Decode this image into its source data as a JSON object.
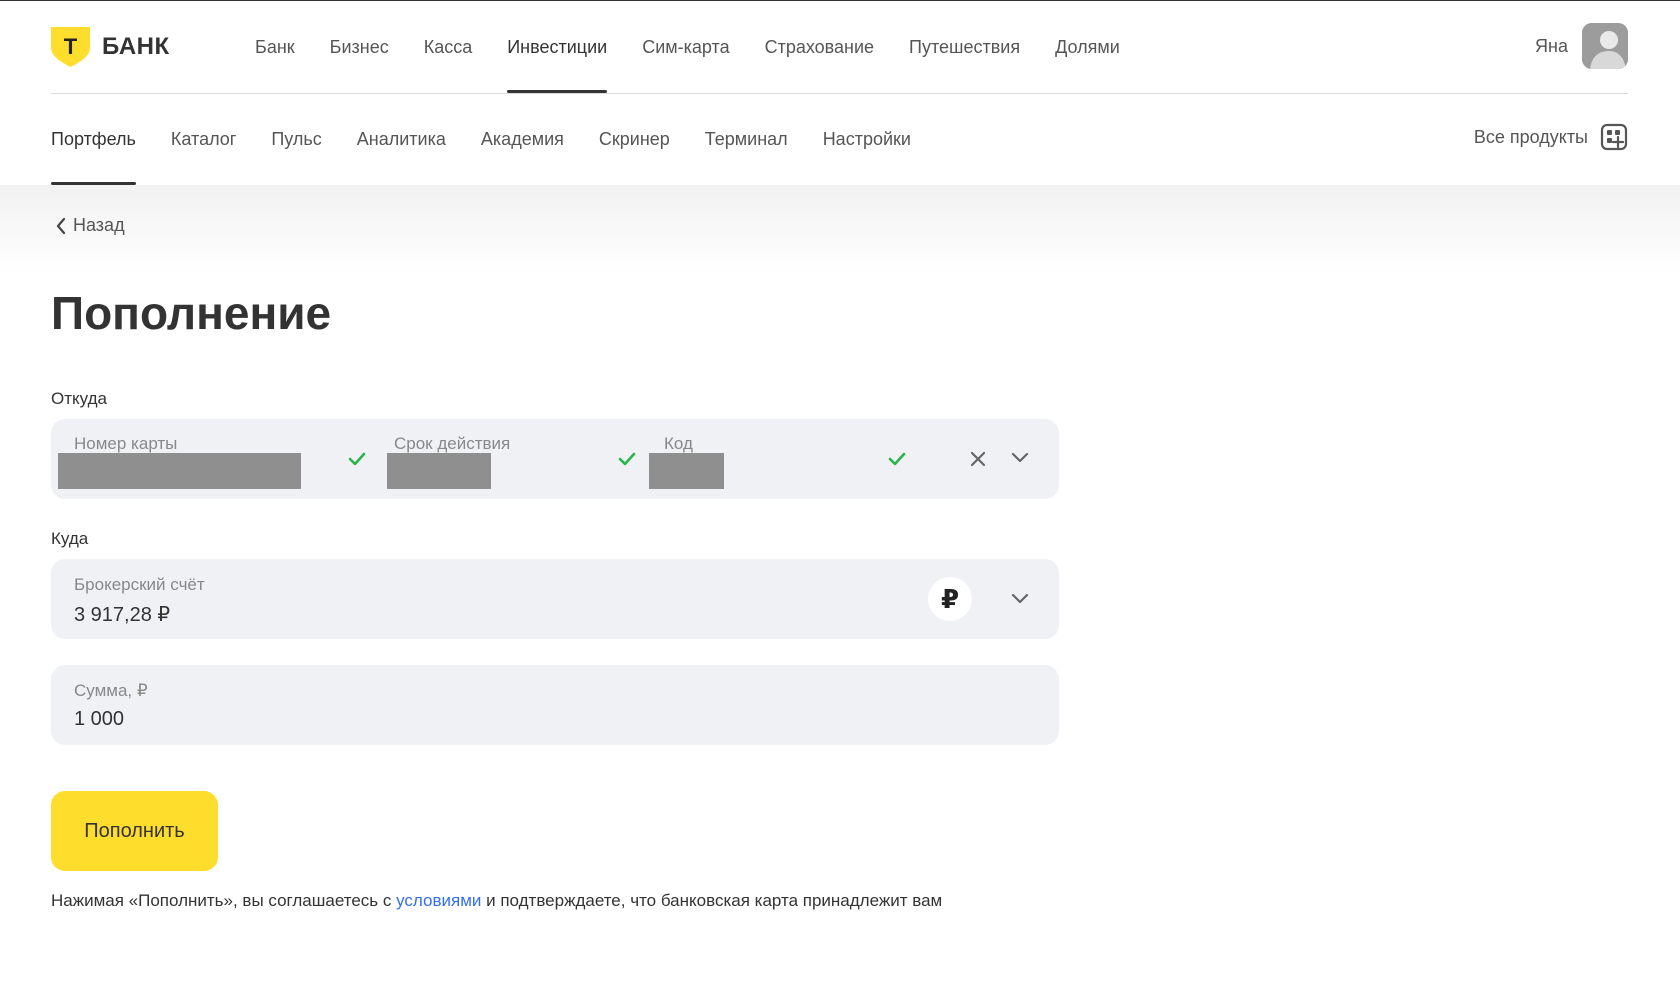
{
  "header": {
    "logo_text": "БАНК",
    "logo_letter": "Т",
    "main_nav": [
      "Банк",
      "Бизнес",
      "Касса",
      "Инвестиции",
      "Сим-карта",
      "Страхование",
      "Путешествия",
      "Долями"
    ],
    "main_nav_active": "Инвестиции",
    "user_name": "Яна"
  },
  "sub_nav": {
    "items": [
      "Портфель",
      "Каталог",
      "Пульс",
      "Аналитика",
      "Академия",
      "Скринер",
      "Терминал",
      "Настройки"
    ],
    "active": "Портфель",
    "all_products": "Все продукты"
  },
  "page": {
    "back": "Назад",
    "title": "Пополнение"
  },
  "from": {
    "label": "Откуда",
    "card_number_caption": "Номер карты",
    "expiry_caption": "Срок действия",
    "code_caption": "Код"
  },
  "to": {
    "label": "Куда",
    "account_caption": "Брокерский счёт",
    "balance": "3 917,28 ₽",
    "currency_symbol": "₽"
  },
  "amount": {
    "caption": "Сумма, ₽",
    "value": "1 000"
  },
  "submit_label": "Пополнить",
  "terms": {
    "before": "Нажимая «Пополнить», вы соглашаетесь с ",
    "link": "условиями",
    "after": " и подтверждаете, что банковская карта принадлежит вам"
  },
  "colors": {
    "accent_yellow": "#ffdd2d",
    "link_blue": "#336fee",
    "check_green": "#2bb44a",
    "field_bg": "#f0f1f5"
  }
}
